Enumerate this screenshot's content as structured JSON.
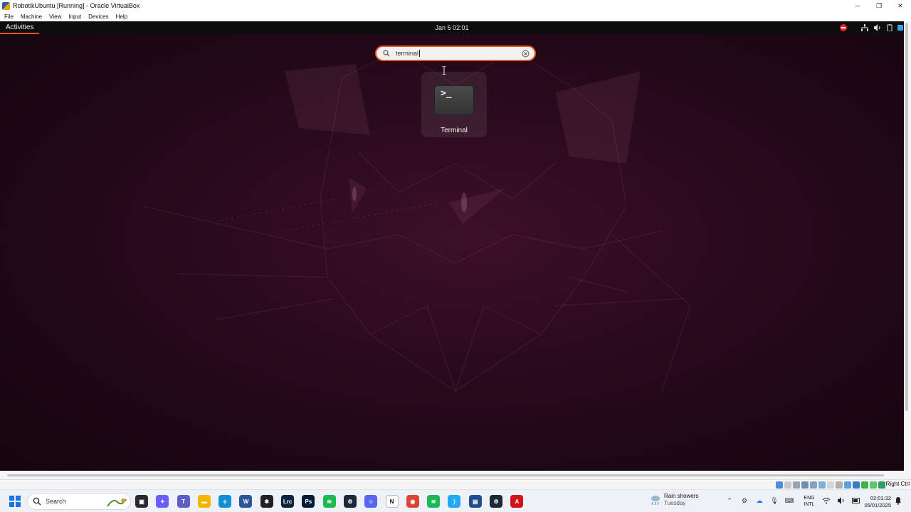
{
  "host_window": {
    "title": "RobotikUbuntu [Running] - Oracle VirtualBox",
    "controls": [
      "minimize",
      "restore",
      "close"
    ]
  },
  "vbox_menu": {
    "items": [
      "File",
      "Machine",
      "View",
      "Input",
      "Devices",
      "Help"
    ]
  },
  "ubuntu_topbar": {
    "activities": "Activities",
    "clock": "Jan 5  02:01"
  },
  "overview": {
    "search_value": "terminal",
    "results": [
      {
        "label": "Terminal",
        "icon": "terminal-icon",
        "glyph": ">_"
      }
    ]
  },
  "vbox_status": {
    "host_key": "Right Ctrl"
  },
  "taskbar": {
    "search_placeholder": "Search",
    "apps": [
      {
        "name": "task-view",
        "color": "#2b2b2b",
        "glyph": "▣"
      },
      {
        "name": "copilot",
        "color": "#6b5cff",
        "glyph": "✦"
      },
      {
        "name": "teams",
        "color": "#5b5fc7",
        "glyph": "T"
      },
      {
        "name": "file-explorer",
        "color": "#f4b400",
        "glyph": "▬"
      },
      {
        "name": "edge",
        "color": "#0f8fd6",
        "glyph": "e"
      },
      {
        "name": "word",
        "color": "#2b579a",
        "glyph": "W"
      },
      {
        "name": "ai-app",
        "color": "#222222",
        "glyph": "✱"
      },
      {
        "name": "lightroom",
        "color": "#0a2540",
        "glyph": "Lrc"
      },
      {
        "name": "photoshop",
        "color": "#001e36",
        "glyph": "Ps"
      },
      {
        "name": "spotify",
        "color": "#1db954",
        "glyph": "≋"
      },
      {
        "name": "steam",
        "color": "#1b2838",
        "glyph": "⚙"
      },
      {
        "name": "discord",
        "color": "#5865f2",
        "glyph": "☺"
      },
      {
        "name": "notion",
        "color": "#ffffff",
        "glyph": "N"
      },
      {
        "name": "chrome",
        "color": "#db4437",
        "glyph": "◉"
      },
      {
        "name": "spotify-2",
        "color": "#1db954",
        "glyph": "≋"
      },
      {
        "name": "vscode",
        "color": "#23a9f2",
        "glyph": "⟩"
      },
      {
        "name": "virtualbox",
        "color": "#1f4e8c",
        "glyph": "▤"
      },
      {
        "name": "steam-2",
        "color": "#1b2838",
        "glyph": "⚙"
      },
      {
        "name": "acrobat",
        "color": "#d4121a",
        "glyph": "A"
      }
    ],
    "weather": {
      "line1": "Rain showers",
      "line2": "Tuesday"
    },
    "language": {
      "line1": "ENG",
      "line2": "INTL"
    },
    "clock": {
      "time": "02:01:32",
      "date": "05/01/2025"
    }
  }
}
